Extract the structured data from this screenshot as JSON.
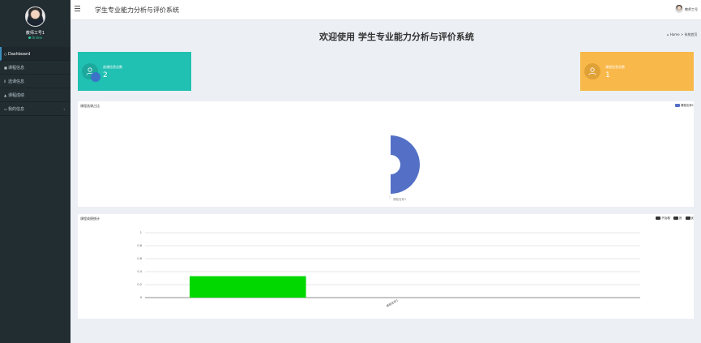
{
  "sidebar": {
    "user": {
      "name": "教师工号1",
      "status": "Online"
    },
    "items": [
      {
        "icon": "○",
        "label": "Dashboard"
      },
      {
        "icon": "■",
        "label": "课程信息"
      },
      {
        "icon": "Ⅱ",
        "label": "选课信息"
      },
      {
        "icon": "▲",
        "label": "课程成绩"
      },
      {
        "icon": "▭",
        "label": "我的信息"
      }
    ]
  },
  "header": {
    "system_title": "学生专业能力分析与评价系统",
    "user_label": "教师工号"
  },
  "page": {
    "heading": "欢迎使用 学生专业能力分析与评价系统",
    "breadcrumb": "Home > 系统首页"
  },
  "cards": [
    {
      "label": "选课信息总数",
      "value": "2",
      "color": "#20c0b2",
      "icon": "user-icon"
    },
    {
      "label": "课程信息总数",
      "value": "1",
      "color": "#f9b84a",
      "icon": "user-icon"
    }
  ],
  "chart_data": [
    {
      "type": "pie",
      "title": "课程选课占比",
      "legend": [
        "课程名称1"
      ],
      "series": [
        {
          "name": "课程名称1",
          "values": [
            1
          ]
        }
      ],
      "slice_label": "课程名称1",
      "color": "#5470c6"
    },
    {
      "type": "bar",
      "title": "课程成绩统计",
      "legend": [
        "不及格",
        "良",
        "优"
      ],
      "legend_colors": [
        "#333333",
        "#333333",
        "#333333"
      ],
      "categories": [
        "课程名称1"
      ],
      "series": [
        {
          "name": "不及格",
          "values": [
            0.33
          ]
        }
      ],
      "ylim": [
        0,
        1
      ],
      "yticks": [
        "0",
        "0.2",
        "0.4",
        "0.6",
        "0.8",
        "1"
      ],
      "bar_color": "#00d800",
      "grid": true
    }
  ]
}
